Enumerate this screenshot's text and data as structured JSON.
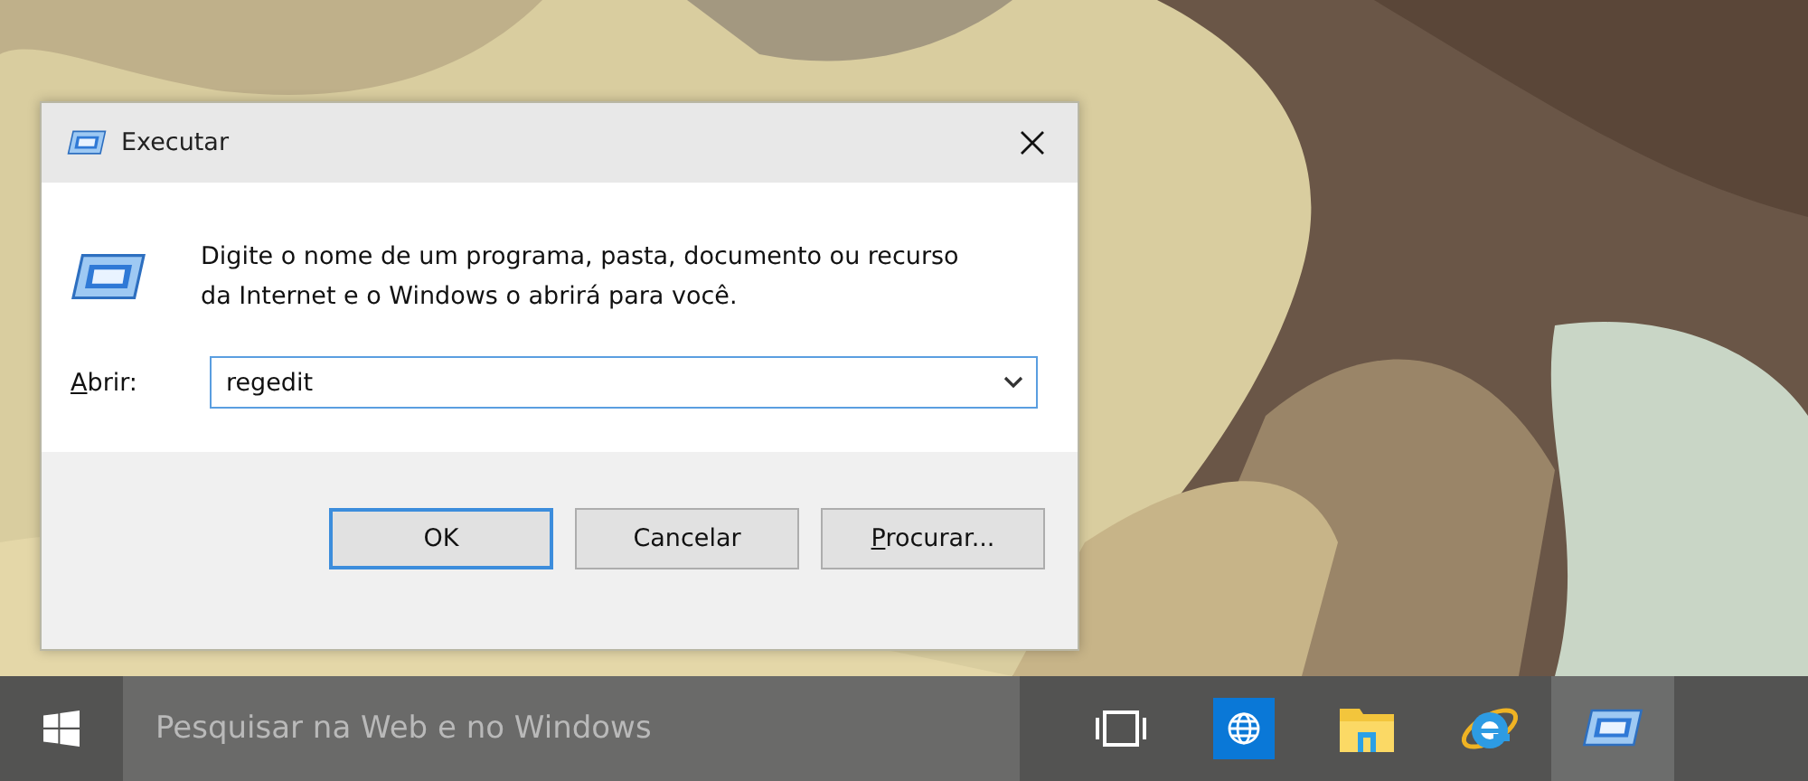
{
  "dialog": {
    "title": "Executar",
    "description": "Digite o nome de um programa, pasta, documento ou recurso da Internet e o Windows o abrirá para você.",
    "open_label": {
      "text": "Abrir:",
      "underline_first": true
    },
    "open_value": "regedit",
    "buttons": [
      {
        "label": "OK",
        "default": true,
        "underline_first": false
      },
      {
        "label": "Cancelar",
        "default": false,
        "underline_first": false
      },
      {
        "label": "Procurar...",
        "default": false,
        "underline_first": true
      }
    ]
  },
  "taskbar": {
    "search": {
      "placeholder": "Pesquisar na Web e no Windows"
    },
    "items": [
      {
        "kind": "taskview",
        "active": false
      },
      {
        "kind": "globe",
        "active": false
      },
      {
        "kind": "folder",
        "active": false
      },
      {
        "kind": "browser",
        "active": false
      },
      {
        "kind": "run",
        "active": true
      }
    ]
  }
}
